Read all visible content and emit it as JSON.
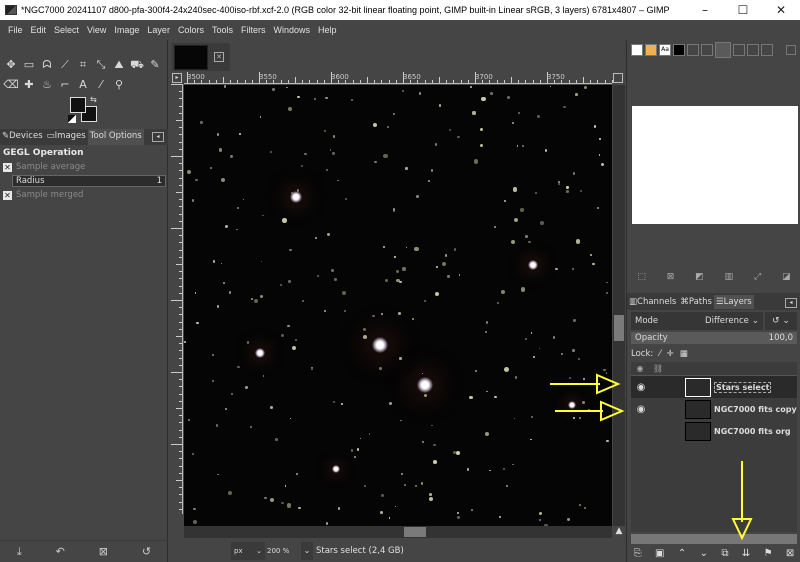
{
  "window": {
    "title": "*NGC7000 20241107 d800-pfa-300f4-24x240sec-400iso-rbf.xcf-2.0 (RGB color 32-bit linear floating point, GIMP built-in Linear sRGB, 3 layers) 6781x4807 – GIMP",
    "minimize": "–",
    "maximize": "☐",
    "close": "✕"
  },
  "menu": [
    "File",
    "Edit",
    "Select",
    "View",
    "Image",
    "Layer",
    "Colors",
    "Tools",
    "Filters",
    "Windows",
    "Help"
  ],
  "toolbox": {
    "row1": [
      "move-tool",
      "rect-select-tool",
      "lasso-tool",
      "fuzzy-select-tool",
      "crop-tool",
      "transform-tool",
      "warp-tool",
      "bucket-fill-tool",
      "paintbrush-tool"
    ],
    "row1_glyphs": [
      "✥",
      "▭",
      "ᗣ",
      "⟋",
      "⌗",
      "⤡",
      "⛰",
      "⛟",
      "✎"
    ],
    "row2": [
      "eraser-tool",
      "heal-tool",
      "smudge-tool",
      "paths-tool",
      "text-tool",
      "color-picker-tool",
      "zoom-tool"
    ],
    "row2_glyphs": [
      "⌫",
      "✚",
      "♨",
      "⌐",
      "A",
      "⁄",
      "⚲"
    ],
    "fg_color": "#111111",
    "bg_color": "#111111"
  },
  "left_dock": {
    "tabs": [
      {
        "label": "Devices",
        "active": false
      },
      {
        "label": "Images",
        "active": false
      },
      {
        "label": "Tool Options",
        "active": true
      }
    ],
    "tool_options": {
      "title": "GEGL Operation",
      "sample_average_label": "Sample average",
      "radius_label": "Radius",
      "radius_value": "1",
      "sample_merged_label": "Sample merged"
    },
    "bottom_buttons": [
      "save-options",
      "restore-options",
      "delete-options",
      "reset-options"
    ],
    "bottom_glyphs": [
      "⤓",
      "↶",
      "⊠",
      "↺"
    ]
  },
  "canvas_area": {
    "ruler_labels": [
      "3500",
      "3550",
      "3600",
      "3650",
      "3700",
      "3750"
    ],
    "status": {
      "unit": "px",
      "zoom": "200 %",
      "text": "Stars select (2,4 GB)"
    }
  },
  "right_dock": {
    "layers_tabs": [
      {
        "label": "Channels",
        "active": false
      },
      {
        "label": "Paths",
        "active": false
      },
      {
        "label": "Layers",
        "active": true
      }
    ],
    "mode_label": "Mode",
    "mode_value": "Difference",
    "opacity_label": "Opacity",
    "opacity_value": "100,0",
    "lock_label": "Lock:",
    "layers": [
      {
        "name": "Stars select",
        "visible": true,
        "selected": true
      },
      {
        "name": "NGC7000 fits copy",
        "visible": true,
        "selected": false
      },
      {
        "name": "NGC7000 fits org",
        "visible": false,
        "selected": false
      }
    ],
    "bottom_glyphs": [
      "⎘",
      "▣",
      "⌃",
      "⌄",
      "⧉",
      "⇊",
      "⚑",
      "⊠"
    ]
  },
  "annotation_color": "#ffff33"
}
